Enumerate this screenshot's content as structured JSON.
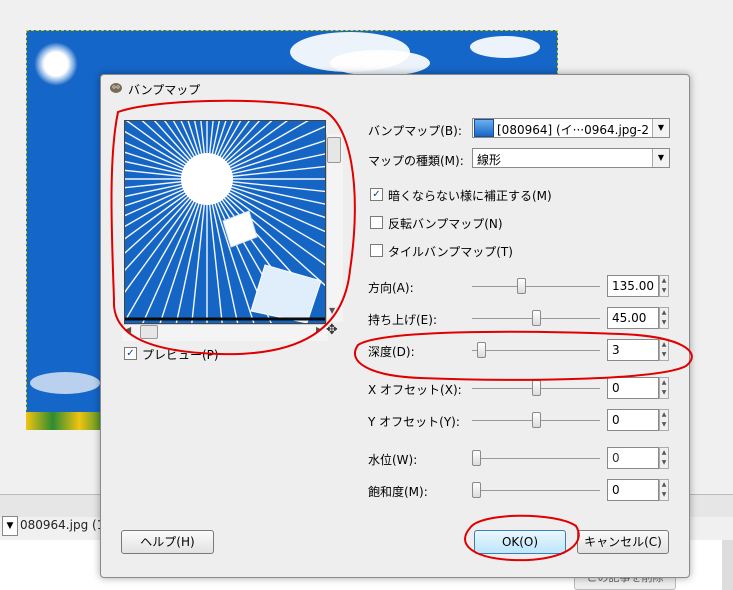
{
  "background": {
    "status_text": "080964.jpg (1",
    "delete_button_label": "この記事を削除"
  },
  "dialog": {
    "title": "バンプマップ",
    "preview_label": "プレビュー(P)",
    "preview_checked": true,
    "bumpmap_label": "バンプマップ(B):",
    "bumpmap_value": "[080964] (イ···0964.jpg-2",
    "map_type_label": "マップの種類(M):",
    "map_type_value": "線形",
    "checkboxes": [
      {
        "label": "暗くならない様に補正する(M)",
        "checked": true
      },
      {
        "label": "反転バンプマップ(N)",
        "checked": false
      },
      {
        "label": "タイルバンプマップ(T)",
        "checked": false
      }
    ],
    "sliders": [
      {
        "label": "方向(A):",
        "value": "135.00",
        "level": 0.375
      },
      {
        "label": "持ち上げ(E):",
        "value": "45.00",
        "level": 0.5
      },
      {
        "label": "深度(D):",
        "value": "3",
        "level": 0.04
      },
      {
        "label": "X オフセット(X):",
        "value": "0",
        "level": 0.5
      },
      {
        "label": "Y オフセット(Y):",
        "value": "0",
        "level": 0.5
      },
      {
        "label": "水位(W):",
        "value": "0",
        "level": 0.0
      },
      {
        "label": "飽和度(M):",
        "value": "0",
        "level": 0.0
      }
    ],
    "buttons": {
      "help": "ヘルプ(H)",
      "ok": "OK(O)",
      "cancel": "キャンセル(C)"
    }
  },
  "colors": {
    "annotation": "#e00000",
    "sky_blue": "#1466c8"
  }
}
